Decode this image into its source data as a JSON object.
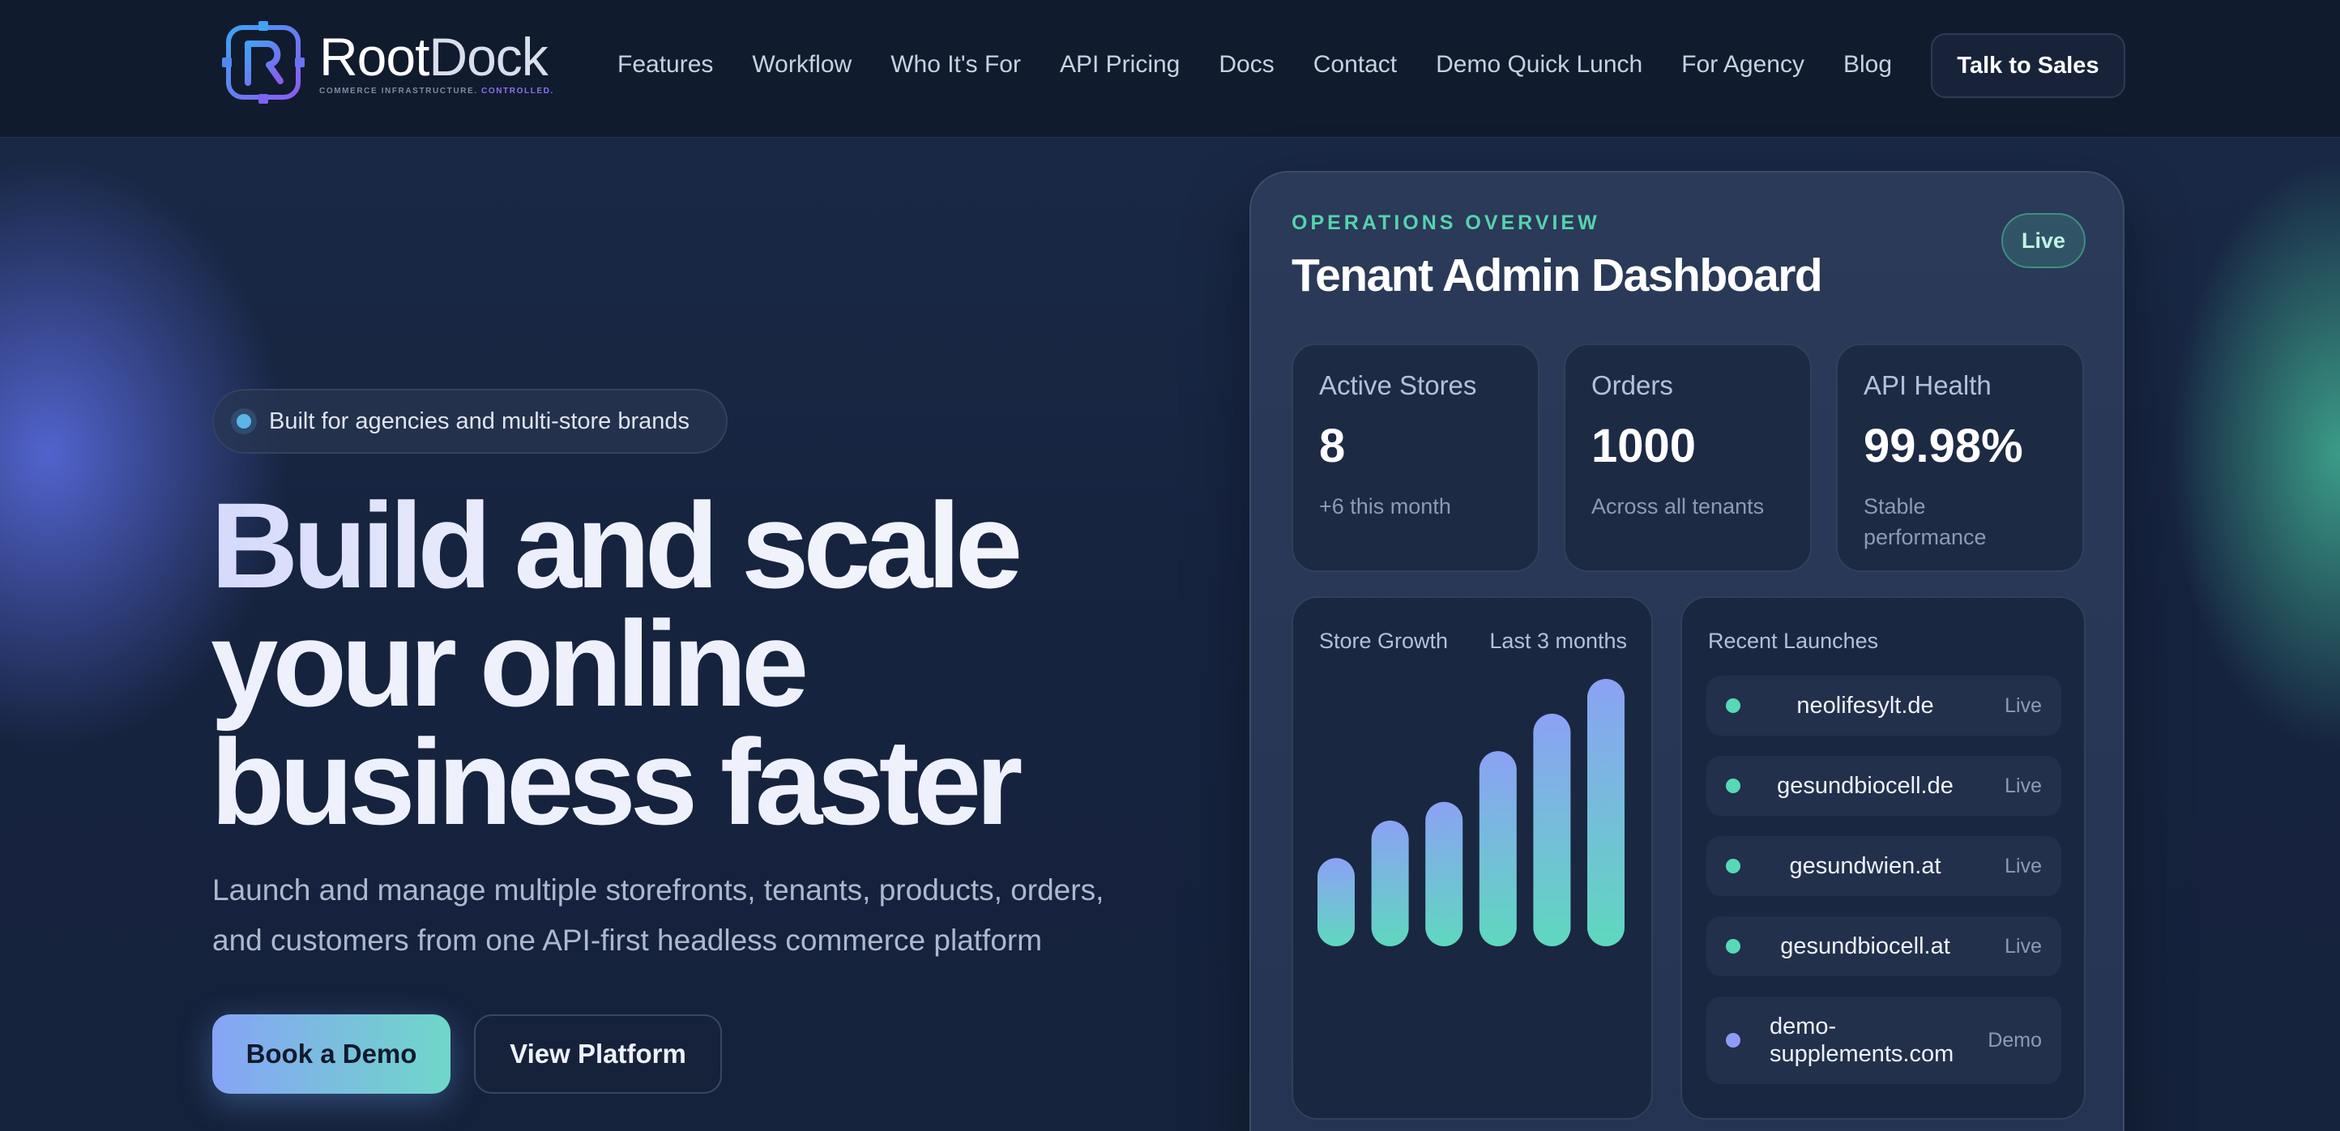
{
  "brand": {
    "name_part1": "Root",
    "name_part2": "Dock",
    "tagline_part1": "COMMERCE INFRASTRUCTURE.",
    "tagline_part2": "CONTROLLED."
  },
  "nav": {
    "items": [
      {
        "label": "Features"
      },
      {
        "label": "Workflow"
      },
      {
        "label": "Who It's For"
      },
      {
        "label": "API Pricing"
      },
      {
        "label": "Docs"
      },
      {
        "label": "Contact"
      },
      {
        "label": "Demo Quick Lunch"
      },
      {
        "label": "For Agency"
      },
      {
        "label": "Blog"
      }
    ],
    "cta_label": "Talk to Sales"
  },
  "hero": {
    "badge": "Built for agencies and multi-store brands",
    "title_line1": "Build and scale",
    "title_line2": "your online",
    "title_line3": "business faster",
    "subtitle_line1": "Launch and manage multiple storefronts, tenants, products, orders,",
    "subtitle_line2": "and customers from one API-first headless commerce platform",
    "primary_button": "Book a Demo",
    "secondary_button": "View Platform"
  },
  "dashboard": {
    "eyebrow": "OPERATIONS OVERVIEW",
    "title": "Tenant Admin Dashboard",
    "status_pill": "Live",
    "stats": [
      {
        "label": "Active Stores",
        "value": "8",
        "note": "+6 this month"
      },
      {
        "label": "Orders",
        "value": "1000",
        "note": "Across all tenants"
      },
      {
        "label": "API Health",
        "value": "99.98%",
        "note_line1": "Stable",
        "note_line2": "performance"
      }
    ],
    "growth": {
      "title": "Store Growth",
      "period": "Last 3 months",
      "bar_levels": [
        0.33,
        0.47,
        0.54,
        0.73,
        0.87,
        1.0
      ]
    },
    "launches": {
      "title": "Recent Launches",
      "items": [
        {
          "name": "neolifesylt.de",
          "status": "Live",
          "dot_color": "#57d9b4"
        },
        {
          "name": "gesundbiocell.de",
          "status": "Live",
          "dot_color": "#57d9b4"
        },
        {
          "name": "gesundwien.at",
          "status": "Live",
          "dot_color": "#57d9b4"
        },
        {
          "name": "gesundbiocell.at",
          "status": "Live",
          "dot_color": "#57d9b4"
        },
        {
          "name_line1": "demo-",
          "name_line2": "supplements.com",
          "status": "Demo",
          "dot_color": "#8f9cf5"
        }
      ]
    }
  },
  "colors": {
    "accent_teal": "#57d2ae",
    "accent_blue": "#86a4f6",
    "background": "#16233d"
  }
}
